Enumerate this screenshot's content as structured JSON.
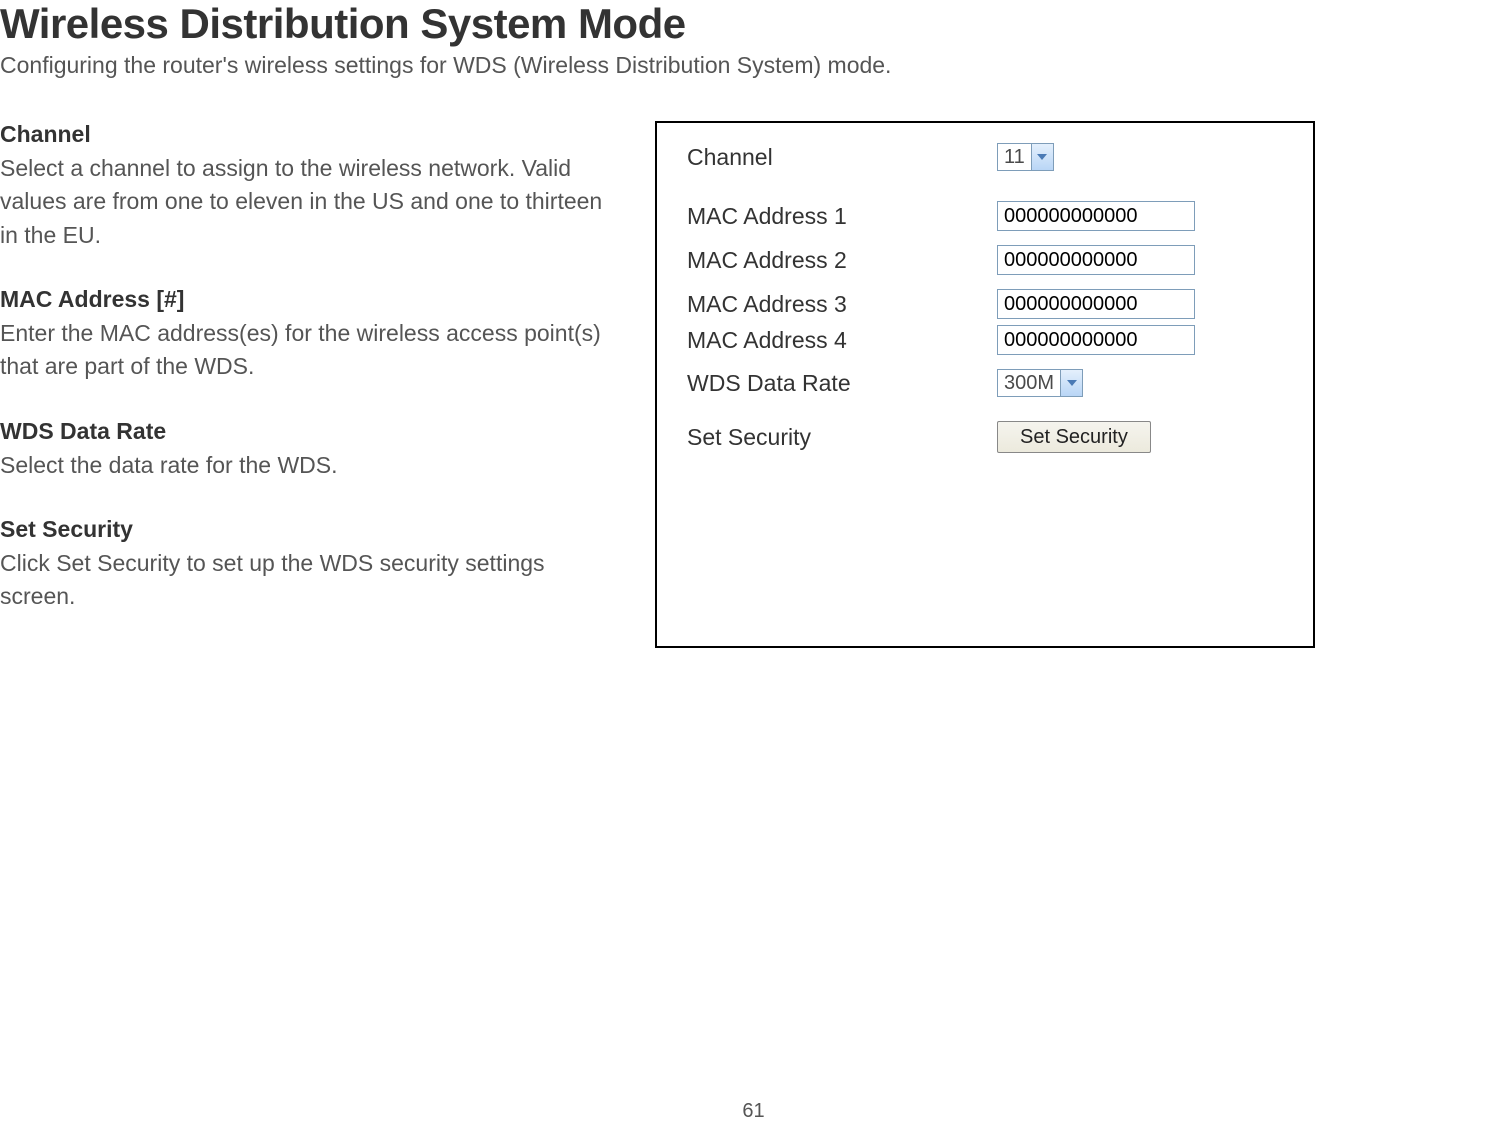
{
  "page": {
    "title": "Wireless Distribution System Mode",
    "subtitle": "Configuring the router's wireless settings for WDS (Wireless Distribution System) mode.",
    "number": "61"
  },
  "sections": {
    "channel": {
      "title": "Channel",
      "body": "Select a channel to assign to the wireless network. Valid values are from one to eleven in the US and one to thirteen in the EU."
    },
    "mac": {
      "title": "MAC Address [#]",
      "body": "Enter the MAC address(es) for the wireless access point(s) that are part of the WDS."
    },
    "rate": {
      "title": "WDS Data Rate",
      "body": "Select the data rate for the WDS."
    },
    "security": {
      "title": "Set Security",
      "body": "Click Set Security to set up the WDS security settings screen."
    }
  },
  "panel": {
    "channel": {
      "label": "Channel",
      "value": "11"
    },
    "mac1": {
      "label": "MAC Address 1",
      "value": "000000000000"
    },
    "mac2": {
      "label": "MAC Address 2",
      "value": "000000000000"
    },
    "mac3": {
      "label": "MAC Address 3",
      "value": "000000000000"
    },
    "mac4": {
      "label": "MAC Address 4",
      "value": "000000000000"
    },
    "rate": {
      "label": "WDS Data Rate",
      "value": "300M"
    },
    "security": {
      "label": "Set Security",
      "button": "Set Security"
    }
  }
}
